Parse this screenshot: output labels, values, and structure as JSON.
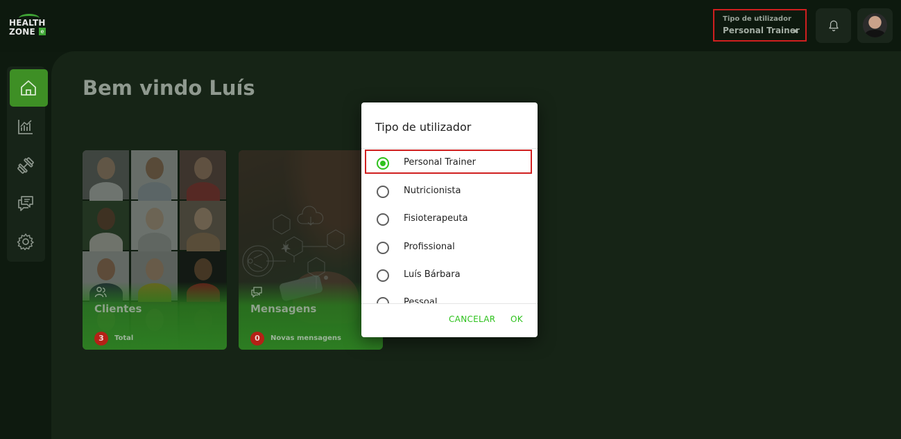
{
  "brand": {
    "line1": "HEALTH",
    "line2": "ZONE",
    "badge": "e",
    "accent": "#3fa535"
  },
  "header": {
    "user_type_label": "Tipo de utilizador",
    "user_type_value": "Personal Trainer",
    "bell_icon": "bell-icon",
    "avatar_icon": "user-avatar"
  },
  "sidebar": {
    "items": [
      {
        "icon": "home-icon",
        "active": true
      },
      {
        "icon": "chart-icon",
        "active": false
      },
      {
        "icon": "dumbbell-icon",
        "active": false
      },
      {
        "icon": "chat-icon",
        "active": false
      },
      {
        "icon": "gear-icon",
        "active": false
      }
    ],
    "active_color": "#3e8f25"
  },
  "main": {
    "welcome": "Bem vindo Luís",
    "cards": [
      {
        "title": "Clientes",
        "count": "3",
        "count_label": "Total",
        "icon": "users-icon"
      },
      {
        "title": "Mensagens",
        "count": "0",
        "count_label": "Novas mensagens",
        "icon": "message-icon"
      }
    ]
  },
  "dialog": {
    "title": "Tipo de utilizador",
    "options": [
      {
        "label": "Personal Trainer",
        "checked": true
      },
      {
        "label": "Nutricionista",
        "checked": false
      },
      {
        "label": "Fisioterapeuta",
        "checked": false
      },
      {
        "label": "Profissional",
        "checked": false
      },
      {
        "label": "Luís Bárbara",
        "checked": false
      },
      {
        "label": "Pessoal",
        "checked": false
      }
    ],
    "cancel_label": "CANCELAR",
    "ok_label": "OK",
    "accent": "#2ec21d",
    "highlight": "#d01f1f"
  }
}
